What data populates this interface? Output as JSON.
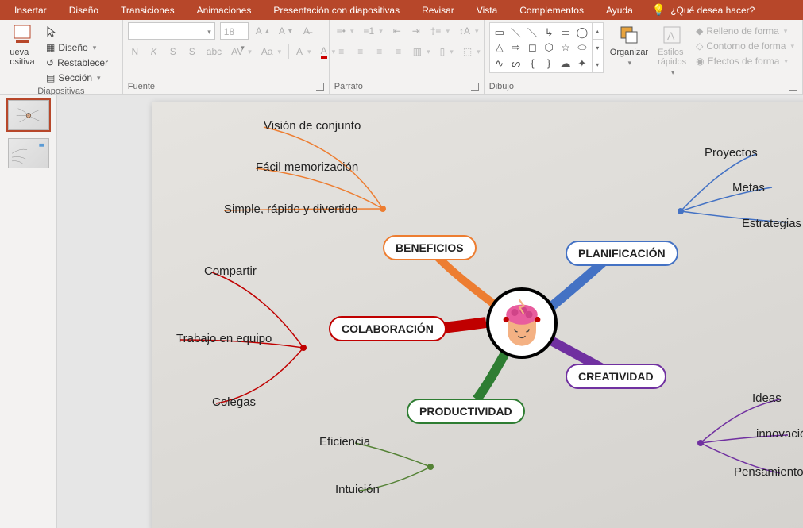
{
  "tabs": {
    "items": [
      "Insertar",
      "Diseño",
      "Transiciones",
      "Animaciones",
      "Presentación con diapositivas",
      "Revisar",
      "Vista",
      "Complementos",
      "Ayuda"
    ],
    "tell_me": "¿Qué desea hacer?"
  },
  "ribbon": {
    "slides": {
      "label": "Diapositivas",
      "new": "ueva\nositiva",
      "layout": "Diseño",
      "reset": "Restablecer",
      "section": "Sección"
    },
    "font": {
      "label": "Fuente",
      "size": "18",
      "b": "N",
      "i": "K",
      "u": "S",
      "shadow": "S",
      "strike": "abc",
      "spacing": "AV",
      "case": "Aa",
      "clear": "A"
    },
    "paragraph": {
      "label": "Párrafo"
    },
    "drawing": {
      "label": "Dibujo",
      "arrange": "Organizar",
      "quick": "Estilos\nrápidos",
      "fill": "Relleno de forma",
      "outline": "Contorno de forma",
      "effects": "Efectos de forma"
    }
  },
  "mindmap": {
    "nodes": {
      "beneficios": "BENEFICIOS",
      "planificacion": "PLANIFICACIÓN",
      "colaboracion": "COLABORACIÓN",
      "creatividad": "CREATIVIDAD",
      "productividad": "PRODUCTIVIDAD"
    },
    "leaves": {
      "vision": "Visión de conjunto",
      "facil": "Fácil memorización",
      "simple": "Simple, rápido y divertido",
      "proyectos": "Proyectos",
      "metas": "Metas",
      "estrategias": "Estrategias",
      "compartir": "Compartir",
      "trabajo": "Trabajo en equipo",
      "colegas": "Colegas",
      "ideas": "Ideas",
      "innovacion": "innovación",
      "pensamientos": "Pensamientos",
      "eficiencia": "Eficiencia",
      "intuicion": "Intuición"
    }
  }
}
